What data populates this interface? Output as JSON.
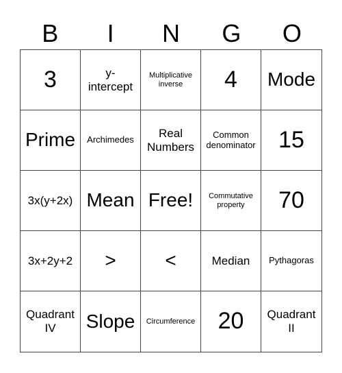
{
  "header": [
    "B",
    "I",
    "N",
    "G",
    "O"
  ],
  "cells": [
    {
      "text": "3",
      "size": "xl"
    },
    {
      "text": "y-\nintercept",
      "size": "m"
    },
    {
      "text": "Multiplicative inverse",
      "size": "xs"
    },
    {
      "text": "4",
      "size": "xl"
    },
    {
      "text": "Mode",
      "size": "l"
    },
    {
      "text": "Prime",
      "size": "l"
    },
    {
      "text": "Archimedes",
      "size": "s"
    },
    {
      "text": "Real Numbers",
      "size": "m"
    },
    {
      "text": "Common denominator",
      "size": "s"
    },
    {
      "text": "15",
      "size": "xl"
    },
    {
      "text": "3x(y+2x)",
      "size": "m"
    },
    {
      "text": "Mean",
      "size": "l"
    },
    {
      "text": "Free!",
      "size": "l"
    },
    {
      "text": "Commutative property",
      "size": "xs"
    },
    {
      "text": "70",
      "size": "xl"
    },
    {
      "text": "3x+2y+2",
      "size": "m"
    },
    {
      "text": ">",
      "size": "l"
    },
    {
      "text": "<",
      "size": "l"
    },
    {
      "text": "Median",
      "size": "m"
    },
    {
      "text": "Pythagoras",
      "size": "s"
    },
    {
      "text": "Quadrant IV",
      "size": "m"
    },
    {
      "text": "Slope",
      "size": "l"
    },
    {
      "text": "Circumference",
      "size": "xs"
    },
    {
      "text": "20",
      "size": "xl"
    },
    {
      "text": "Quadrant II",
      "size": "m"
    }
  ]
}
